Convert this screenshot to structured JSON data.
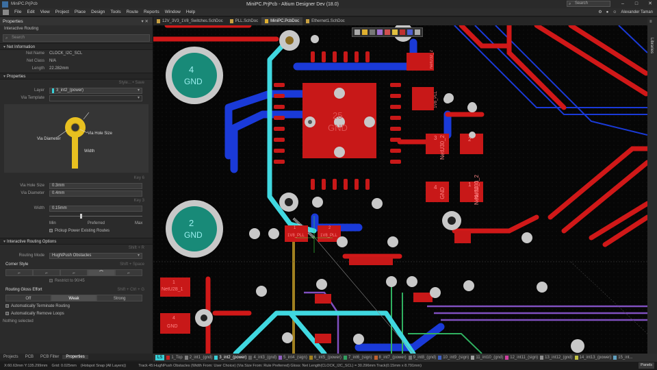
{
  "window": {
    "file": "MiniPC.PrjPcb",
    "title": "MiniPC.PrjPcb - Altium Designer Dev (18.0)",
    "search_placeholder": "Search",
    "user": "Alexander Taman"
  },
  "menu": [
    "File",
    "Edit",
    "View",
    "Project",
    "Place",
    "Design",
    "Tools",
    "Route",
    "Reports",
    "Window",
    "Help"
  ],
  "panel": {
    "title": "Properties",
    "subtitle": "Interactive Routing",
    "search_placeholder": "Search",
    "net_info": {
      "header": "Net Information",
      "net_name_label": "Net Name",
      "net_name": "CLOCK_I2C_SCL",
      "net_class_label": "Net Class",
      "net_class": "N/A",
      "length_label": "Length",
      "length": "22.282mm"
    },
    "properties": {
      "header": "Properties",
      "style_hint": "Style... • Save",
      "layer_label": "Layer",
      "layer": "3_int2_(power)",
      "via_template_label": "Via Template",
      "diagram": {
        "via_diameter": "Via Diameter",
        "via_hole_size": "Via Hole Size",
        "width": "Width"
      },
      "key_hint_1": "Key 6",
      "via_hole_label": "Via Hole Size",
      "via_hole": "0.3mm",
      "via_diameter_label": "Via Diameter",
      "via_diameter": "0.4mm",
      "key_hint_2": "Key 3",
      "width_label": "Width",
      "width": "0.15mm",
      "slider_min": "Min",
      "slider_pref": "Preferred",
      "slider_max": "Max",
      "pickup": "Pickup Power Existing Routes"
    },
    "ir_options": {
      "header": "Interactive Routing Options",
      "shift_hint": "Shift + R",
      "routing_mode_label": "Routing Mode",
      "routing_mode": "HugNPush Obstacles",
      "corner_style": "Corner Style",
      "corner_hint": "Shift + Space",
      "restrict": "Restrict to 90/45",
      "glossing": "Routing Gloss Effort",
      "glossing_hint": "Shift + Ctrl + G",
      "gloss_opts": [
        "Off",
        "Weak",
        "Strong"
      ],
      "auto_terminate": "Automatically Terminate Routing",
      "auto_remove": "Automatically Remove Loops"
    },
    "selection": "Nothing selected",
    "tabs": [
      "Projects",
      "PCB",
      "PCB Filter",
      "Properties"
    ]
  },
  "doc_tabs": [
    "12V_3V3_1V8_Switches.SchDoc",
    "PLL.SchDoc",
    "MiniPC.PcbDoc",
    "Ethernet1.SchDoc"
  ],
  "pcb": {
    "gnd4": "4",
    "gnd_a": "GND",
    "gnd2": "2",
    "gnd_b": "GND",
    "u25_num": "25",
    "u25_net": "GND",
    "p1": "1",
    "p1_net": "1V8_PLL",
    "p2": "2",
    "p2_net": "1V8_PLL",
    "r3": "3",
    "r3_net": "NetU30_2",
    "r2": "2",
    "r2_net": "NetU30_2",
    "r4": "4",
    "r4_net": "GND",
    "r1": "1",
    "r1_net": "NetU30_1",
    "l1": "1",
    "l1_net": "NetU28_1",
    "l4": "4",
    "l4_net": "GND",
    "t1": "NetU32_2",
    "t2": "1V8_PLL"
  },
  "side_label": "Libraries",
  "layers": {
    "current": "LS",
    "items": [
      {
        "name": "1_Top",
        "color": "#c82020"
      },
      {
        "name": "2_int1_(gnd)",
        "color": "#808080"
      },
      {
        "name": "3_int2_(power)",
        "color": "#39d0d8"
      },
      {
        "name": "4_int3_(gnd)",
        "color": "#606060"
      },
      {
        "name": "5_int4_(sign)",
        "color": "#9060c0"
      },
      {
        "name": "6_int5_(power)",
        "color": "#a08020"
      },
      {
        "name": "7_int6_(sign)",
        "color": "#30a060"
      },
      {
        "name": "8_int7_(power)",
        "color": "#c06030"
      },
      {
        "name": "9_int8_(gnd)",
        "color": "#707070"
      },
      {
        "name": "10_int9_(sign)",
        "color": "#4060c0"
      },
      {
        "name": "11_int10_(gnd)",
        "color": "#a0a0a0"
      },
      {
        "name": "12_int11_(sign)",
        "color": "#d040a0"
      },
      {
        "name": "13_int12_(gnd)",
        "color": "#909090"
      },
      {
        "name": "14_int13_(power)",
        "color": "#c0c040"
      },
      {
        "name": "15_int...",
        "color": "#60a0c0"
      }
    ]
  },
  "status": {
    "coords": "X:60.63mm Y:135.299mm",
    "grid": "Grid: 0.025mm",
    "snap": "(Hotspot Snap (All Layers))",
    "track": "Track 45:HugNPush Obstacles (Width From: User Choice) (Via Size From: Rule Preferred) Gloss: Net Length(CLOCK_I2C_SCL) = 30.296mm Track(0.15mm x 8.791mm)",
    "panels": "Panels"
  }
}
